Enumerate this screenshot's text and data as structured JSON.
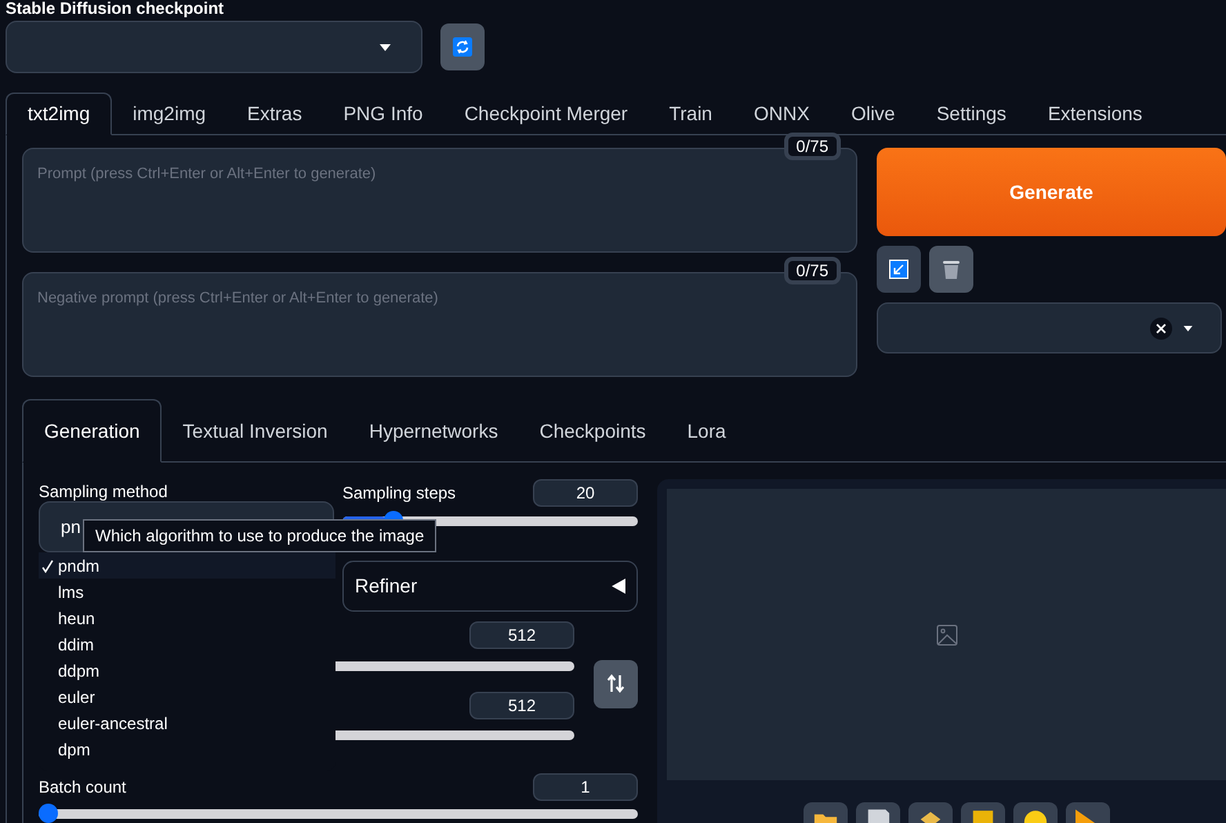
{
  "checkpoint": {
    "label": "Stable Diffusion checkpoint"
  },
  "tabs": [
    {
      "label": "txt2img",
      "selected": true
    },
    {
      "label": "img2img",
      "selected": false
    },
    {
      "label": "Extras",
      "selected": false
    },
    {
      "label": "PNG Info",
      "selected": false
    },
    {
      "label": "Checkpoint Merger",
      "selected": false
    },
    {
      "label": "Train",
      "selected": false
    },
    {
      "label": "ONNX",
      "selected": false
    },
    {
      "label": "Olive",
      "selected": false
    },
    {
      "label": "Settings",
      "selected": false
    },
    {
      "label": "Extensions",
      "selected": false
    }
  ],
  "prompt": {
    "placeholder": "Prompt (press Ctrl+Enter or Alt+Enter to generate)",
    "counter": "0/75"
  },
  "negative_prompt": {
    "placeholder": "Negative prompt (press Ctrl+Enter or Alt+Enter to generate)",
    "counter": "0/75"
  },
  "generate_button": "Generate",
  "style_checkbox": {
    "checked": true
  },
  "subtabs": [
    {
      "label": "Generation",
      "selected": true
    },
    {
      "label": "Textual Inversion",
      "selected": false
    },
    {
      "label": "Hypernetworks",
      "selected": false
    },
    {
      "label": "Checkpoints",
      "selected": false
    },
    {
      "label": "Lora",
      "selected": false
    }
  ],
  "sampling_method": {
    "label": "Sampling method",
    "value": "pn",
    "tooltip": "Which algorithm to use to produce the image",
    "options": [
      {
        "label": "pndm",
        "selected": true
      },
      {
        "label": "lms",
        "selected": false
      },
      {
        "label": "heun",
        "selected": false
      },
      {
        "label": "ddim",
        "selected": false
      },
      {
        "label": "ddpm",
        "selected": false
      },
      {
        "label": "euler",
        "selected": false
      },
      {
        "label": "euler-ancestral",
        "selected": false
      },
      {
        "label": "dpm",
        "selected": false
      }
    ]
  },
  "sampling_steps": {
    "label": "Sampling steps",
    "value": "20",
    "level": 0.15
  },
  "refiner": {
    "label": "Refiner",
    "expanded": false
  },
  "width": {
    "value": "512"
  },
  "height": {
    "value": "512"
  },
  "batch_count": {
    "label": "Batch count",
    "value": "1",
    "level": 0
  }
}
